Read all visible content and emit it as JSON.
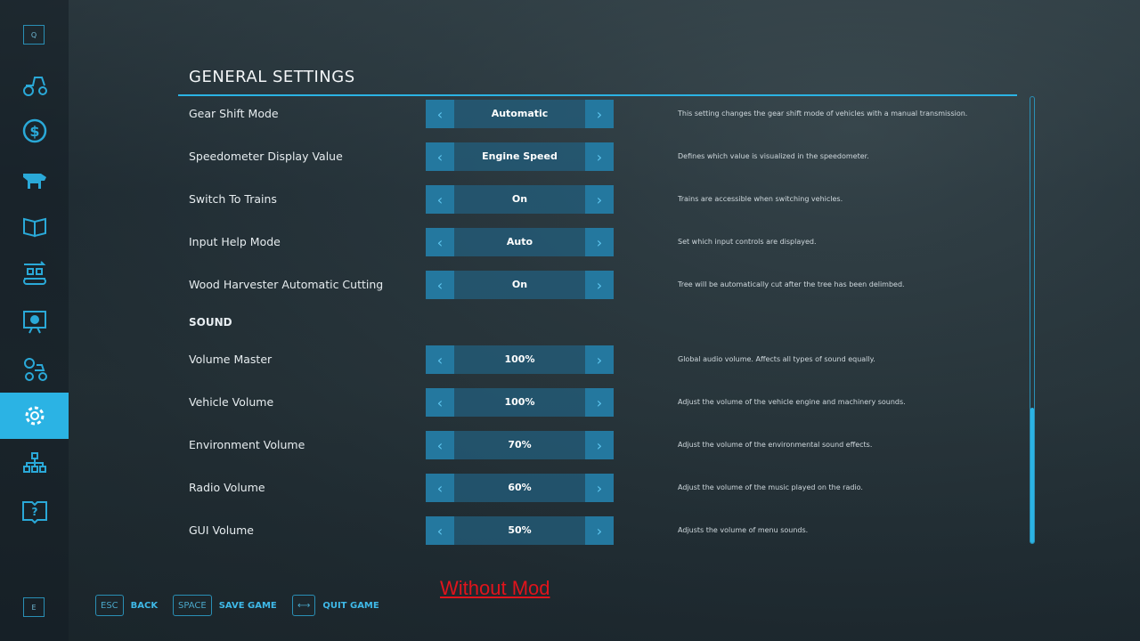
{
  "sidebar": {
    "top_key": "Q",
    "bottom_key": "E",
    "items": [
      {
        "icon": "tractor-icon"
      },
      {
        "icon": "dollar-icon"
      },
      {
        "icon": "cow-icon"
      },
      {
        "icon": "contracts-icon"
      },
      {
        "icon": "production-icon"
      },
      {
        "icon": "presentation-icon"
      },
      {
        "icon": "vehicle-settings-icon"
      },
      {
        "icon": "gear-icon",
        "active": true
      },
      {
        "icon": "hierarchy-icon"
      },
      {
        "icon": "help-book-icon"
      }
    ]
  },
  "header": {
    "title": "GENERAL SETTINGS"
  },
  "general": [
    {
      "label": "Gear Shift Mode",
      "value": "Automatic",
      "desc": "This setting changes the gear shift mode of vehicles with a manual transmission."
    },
    {
      "label": "Speedometer Display Value",
      "value": "Engine Speed",
      "desc": "Defines which value is visualized in the speedometer."
    },
    {
      "label": "Switch To Trains",
      "value": "On",
      "desc": "Trains are accessible when switching vehicles."
    },
    {
      "label": "Input Help Mode",
      "value": "Auto",
      "desc": "Set which input controls are displayed."
    },
    {
      "label": "Wood Harvester Automatic Cutting",
      "value": "On",
      "desc": "Tree will be automatically cut after the tree has been delimbed."
    }
  ],
  "sound_title": "SOUND",
  "sound": [
    {
      "label": "Volume Master",
      "value": "100%",
      "desc": "Global audio volume. Affects all types of sound equally."
    },
    {
      "label": "Vehicle Volume",
      "value": "100%",
      "desc": "Adjust the volume of the vehicle engine and machinery sounds."
    },
    {
      "label": "Environment Volume",
      "value": "70%",
      "desc": "Adjust the volume of the environmental sound effects."
    },
    {
      "label": "Radio Volume",
      "value": "60%",
      "desc": "Adjust the volume of the music played on the radio."
    },
    {
      "label": "GUI Volume",
      "value": "50%",
      "desc": "Adjusts the volume of menu sounds."
    }
  ],
  "arrows": {
    "left": "‹",
    "right": "›"
  },
  "footer": [
    {
      "key": "ESC",
      "label": "BACK"
    },
    {
      "key": "SPACE",
      "label": "SAVE GAME"
    },
    {
      "key": "⟷",
      "label": "QUIT GAME"
    }
  ],
  "annotation": "Without Mod",
  "colors": {
    "accent": "#2bb3e4",
    "annotation": "#e0141c"
  }
}
